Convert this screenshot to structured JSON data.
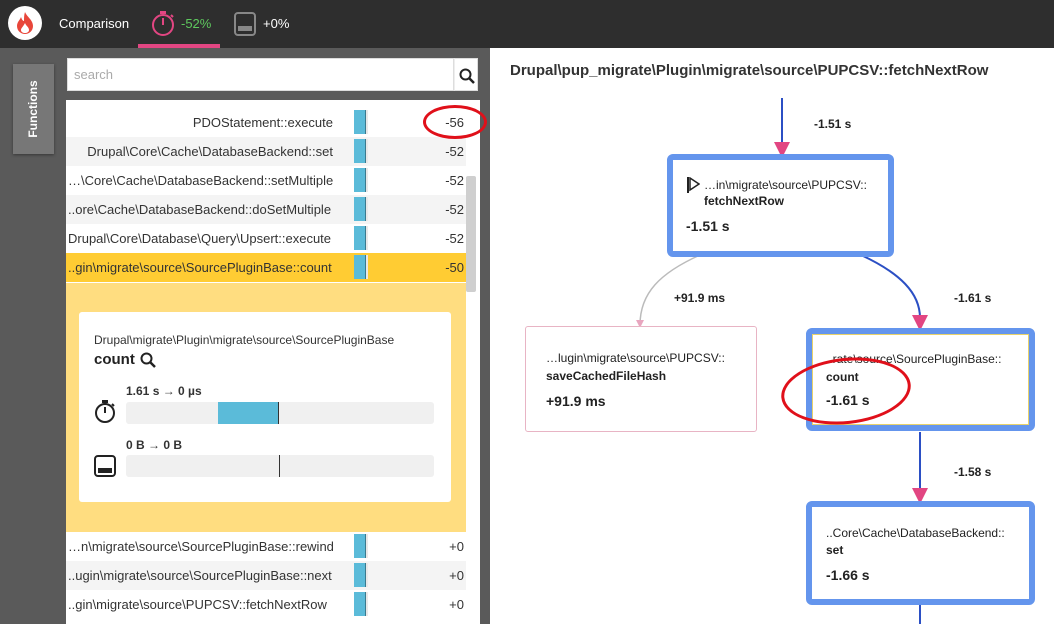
{
  "topbar": {
    "comparison_label": "Comparison",
    "time_metric": "-52%",
    "memory_metric": "+0%",
    "accent": "#e24682",
    "positive_color": "#5ec85e"
  },
  "sidebar": {
    "functions_tab": "Functions"
  },
  "search": {
    "placeholder": "search",
    "value": ""
  },
  "functions": [
    {
      "name": "PDOStatement::execute",
      "value": "-56"
    },
    {
      "name": "Drupal\\Core\\Cache\\DatabaseBackend::set",
      "value": "-52"
    },
    {
      "name": "…\\Core\\Cache\\DatabaseBackend::setMultiple",
      "value": "-52"
    },
    {
      "name": "..ore\\Cache\\DatabaseBackend::doSetMultiple",
      "value": "-52"
    },
    {
      "name": "Drupal\\Core\\Database\\Query\\Upsert::execute",
      "value": "-52"
    },
    {
      "name": "..gin\\migrate\\source\\SourcePluginBase::count",
      "value": "-50"
    },
    {
      "name": "…n\\migrate\\source\\SourcePluginBase::rewind",
      "value": "+0"
    },
    {
      "name": "..ugin\\migrate\\source\\SourcePluginBase::next",
      "value": "+0"
    },
    {
      "name": "..gin\\migrate\\source\\PUPCSV::fetchNextRow",
      "value": "+0"
    }
  ],
  "detail": {
    "namespace": "Drupal\\migrate\\Plugin\\migrate\\source\\SourcePluginBase",
    "function": "count",
    "time_change": "1.61 s → 0 µs",
    "memory_change": "0 B → 0 B"
  },
  "graph": {
    "title": "Drupal\\pup_migrate\\Plugin\\migrate\\source\\PUPCSV::fetchNextRow",
    "edges": {
      "incoming": "-1.51 s",
      "to_save": "+91.9 ms",
      "to_count": "-1.61 s",
      "to_set": "-1.58 s"
    },
    "nodes": {
      "root": {
        "ns": "…in\\migrate\\source\\PUPCSV::",
        "fn": "fetchNextRow",
        "time": "-1.51 s"
      },
      "save": {
        "ns": "…lugin\\migrate\\source\\PUPCSV::",
        "fn": "saveCachedFileHash",
        "time": "+91.9 ms"
      },
      "count": {
        "ns": "..rate\\source\\SourcePluginBase::",
        "fn": "count",
        "time": "-1.61 s"
      },
      "set": {
        "ns": "..Core\\Cache\\DatabaseBackend::",
        "fn": "set",
        "time": "-1.66 s"
      }
    }
  }
}
